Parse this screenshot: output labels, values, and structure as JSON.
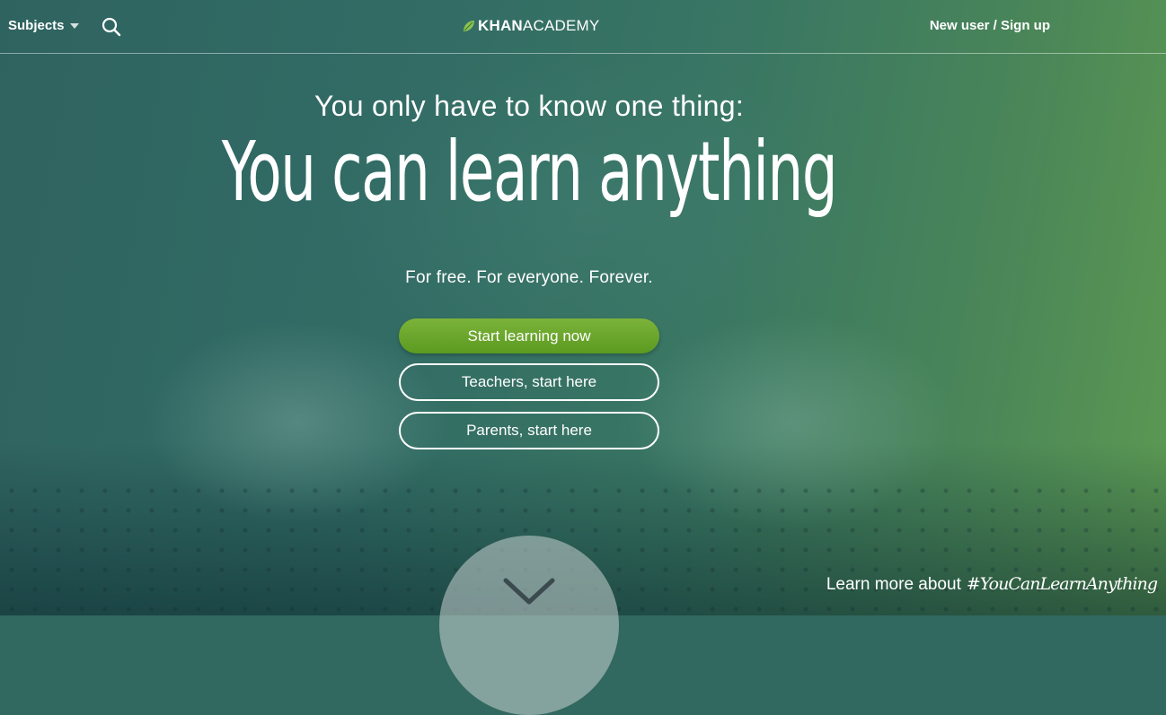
{
  "nav": {
    "subjects_label": "Subjects",
    "logo_bold": "KHAN",
    "logo_light": "ACADEMY",
    "signup_label": "New user / Sign up"
  },
  "hero": {
    "intro": "You only have to know one thing:",
    "headline": "You can learn anything",
    "tagline": "For free. For everyone. Forever."
  },
  "buttons": {
    "start": "Start learning now",
    "teachers": "Teachers, start here",
    "parents": "Parents, start here"
  },
  "footer": {
    "learn_more": "Learn more about",
    "hashtag": "#YouCanLearnAnything"
  },
  "icons": {
    "search": "search-icon",
    "leaf": "leaf-icon",
    "caret": "caret-down-icon",
    "scroll": "chevron-down-icon"
  },
  "colors": {
    "primary_button": "#6ea82c",
    "hero_overlay_start": "#2f6360",
    "hero_overlay_end": "#5d9a52"
  }
}
